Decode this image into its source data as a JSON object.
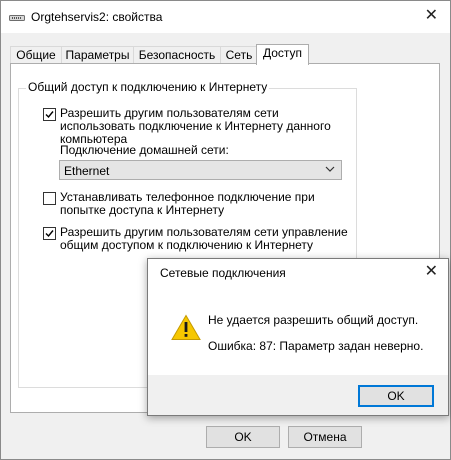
{
  "window": {
    "title": "Orgtehservis2: свойства",
    "close_glyph": "✕"
  },
  "tabs": [
    {
      "label": "Общие"
    },
    {
      "label": "Параметры"
    },
    {
      "label": "Безопасность"
    },
    {
      "label": "Сеть"
    },
    {
      "label": "Доступ",
      "active": true
    }
  ],
  "sharing": {
    "group_label": "Общий доступ к подключению к Интернету",
    "allow_share": {
      "checked": true,
      "label_lines": [
        "Разрешить другим пользователям сети",
        "использовать подключение к Интернету данного",
        "компьютера"
      ]
    },
    "home_network_label": "Подключение домашней сети:",
    "home_network_value": "Ethernet",
    "dialup": {
      "checked": false,
      "label_lines": [
        "Устанавливать телефонное подключение при",
        "попытке доступа к Интернету"
      ]
    },
    "allow_control": {
      "checked": true,
      "label_lines": [
        "Разрешить другим пользователям сети управление",
        "общим доступом к подключению к Интернету"
      ]
    }
  },
  "buttons": {
    "ok": "OK",
    "cancel": "Отмена"
  },
  "dialog": {
    "title": "Сетевые подключения",
    "close_glyph": "✕",
    "message": "Не удается разрешить общий доступ.",
    "error": "Ошибка: 87: Параметр задан неверно.",
    "ok": "OK",
    "icon": "warning-icon"
  },
  "colors": {
    "focus_blue": "#0078d7",
    "warning_yellow": "#f6c700"
  }
}
